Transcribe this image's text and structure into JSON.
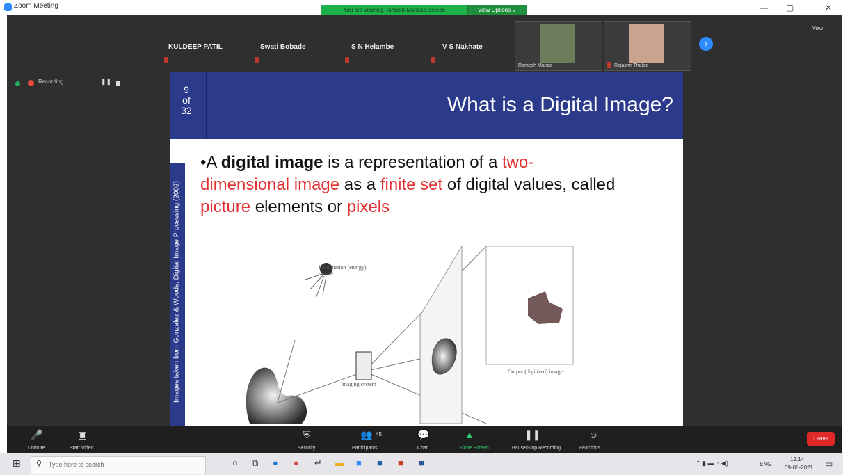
{
  "window": {
    "title": "Zoom Meeting"
  },
  "banner": {
    "sharing_text": "You are viewing Ramesh Manza's screen",
    "view_options": "View Options ⌄"
  },
  "participants": {
    "names": [
      "KULDEEP PATIL",
      "Swati Bobade",
      "S N Helambe",
      "V S Nakhate"
    ],
    "video": [
      "Ramesh Manza",
      "Rajashri Thakre"
    ],
    "view_label": "View"
  },
  "recording": {
    "label": "Recording..."
  },
  "slide": {
    "counter": [
      "9",
      "of",
      "32"
    ],
    "title": "What is a Digital Image?",
    "side_credit": "Images taken from Gonzalez & Woods, Digital Image Processing (2002)",
    "body": {
      "bullet": "•A ",
      "bold": "digital image",
      "t1": " is a representation of a ",
      "red1": "two-dimensional image",
      "t2": " as a ",
      "red2": "finite set",
      "t3": " of digital values, called ",
      "red3": "picture",
      "t4": " elements or ",
      "red4": "pixels"
    },
    "figure": {
      "illumination": "Illumination (energy) source",
      "imaging": "Imaging system",
      "output": "Output (digitized) image"
    }
  },
  "toolbar": {
    "unmute": "Unmute",
    "start_video": "Start Video",
    "security": "Security",
    "participants": "Participants",
    "participants_count": "45",
    "chat": "Chat",
    "share_screen": "Share Screen",
    "pause_recording": "Pause/Stop Recording",
    "reactions": "Reactions",
    "leave": "Leave"
  },
  "taskbar": {
    "search_placeholder": "Type here to search",
    "tray_lang": "ENG",
    "time": "12:14",
    "date": "09-08-2021"
  },
  "colors": {
    "slide_blue": "#2c3a8c",
    "accent_red": "#e03232",
    "zoom_blue": "#2d8cff",
    "share_green": "#1db14b"
  }
}
